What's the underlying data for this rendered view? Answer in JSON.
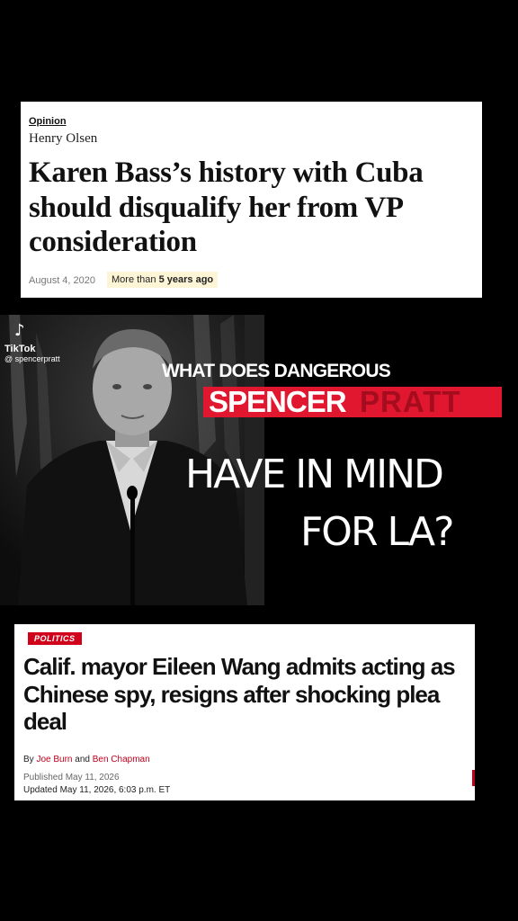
{
  "article1": {
    "section": "Opinion",
    "author": "Henry Olsen",
    "headline": "Karen Bass’s history with Cuba should disqualify her from VP consideration",
    "date": "August 4, 2020",
    "badge_prefix": "More than ",
    "badge_bold": "5 years ago"
  },
  "video": {
    "brand": "TikTok",
    "handle": "@ spencerpratt"
  },
  "overlay": {
    "line1": "What does dangerous",
    "first_name": "SPENCER",
    "last_name": "PRATT",
    "line3": "HAVE IN MIND",
    "line4": "FOR LA?",
    "accent_color": "#e0172f"
  },
  "article2": {
    "category": "POLITICS",
    "headline": "Calif. mayor Eileen Wang admits acting as Chinese spy, resigns after shocking plea deal",
    "by_prefix": "By ",
    "author1": "Joe Burn",
    "by_and": " and ",
    "author2": "Ben Chapman",
    "published": "Published May 11, 2026",
    "updated": "Updated May 11, 2026, 6:03 p.m. ET"
  }
}
